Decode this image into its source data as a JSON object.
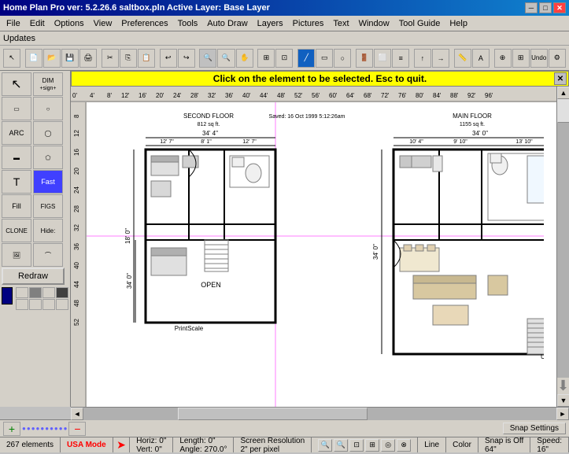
{
  "titlebar": {
    "title": "Home Plan Pro ver: 5.2.26.6   saltbox.pln     Active Layer: Base Layer",
    "minimize": "─",
    "maximize": "□",
    "close": "✕"
  },
  "menubar": {
    "items": [
      "File",
      "Edit",
      "Options",
      "View",
      "Preferences",
      "Tools",
      "Auto Draw",
      "Layers",
      "Pictures",
      "Text",
      "Window",
      "Tool Guide",
      "Help"
    ]
  },
  "updatesbar": {
    "label": "Updates"
  },
  "notification": {
    "text": "Click on the element to be selected.  Esc to quit.",
    "close": "✕"
  },
  "left_toolbar": {
    "dim_label": "DIM",
    "sign_label": "+sign+",
    "arc_label": "ARC",
    "t_label": "T",
    "fast_label": "Fast",
    "fill_label": "Fill",
    "figs_label": "FIGS",
    "clone_label": "CLONE",
    "hide_label": "Hide:",
    "redraw_label": "Redraw"
  },
  "statusbar": {
    "horiz": "Horiz: 0\"",
    "vert": "Vert: 0\"",
    "length": "Length: 0\"",
    "angle": "Angle: 270.0°",
    "screen_res": "Screen Resolution",
    "per_pixel": "2\" per pixel",
    "elements": "267 elements",
    "usa_mode": "USA Mode",
    "line_label": "Line",
    "color_label": "Color",
    "snap_off": "Snap is Off",
    "snap_value": "64\"",
    "speed_label": "Speed:",
    "speed_value": "16\""
  },
  "bottom_toolbar": {
    "add_icon": "+",
    "circles": [
      "●",
      "●",
      "●",
      "●",
      "●",
      "●",
      "●",
      "●",
      "●",
      "●"
    ],
    "minus_icon": "−",
    "snap_settings": "Snap Settings"
  },
  "ruler": {
    "marks": [
      "0'",
      "4'",
      "8'",
      "12'",
      "16'",
      "20'",
      "24'",
      "28'",
      "32'",
      "36'",
      "40'",
      "44'",
      "48'",
      "52'",
      "56'",
      "60'",
      "64'",
      "68'",
      "72'",
      "76'",
      "80'",
      "84'",
      "88'",
      "92'",
      "96'"
    ]
  }
}
